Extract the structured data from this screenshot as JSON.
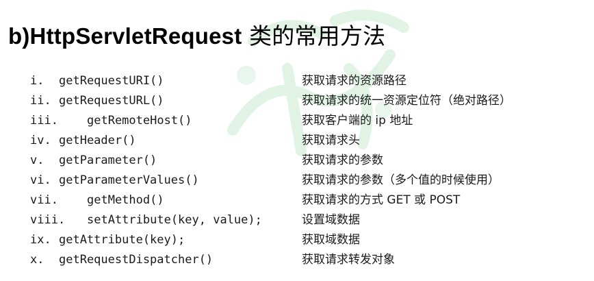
{
  "title": {
    "latin": "b)HttpServletRequest",
    "cjk": " 类的常用方法"
  },
  "rows": [
    {
      "num": "i.",
      "method": "getRequestURI()",
      "desc": "获取请求的资源路径"
    },
    {
      "num": "ii.",
      "method": "getRequestURL()",
      "desc": "获取请求的统一资源定位符（绝对路径）"
    },
    {
      "num": "iii.",
      "method": "getRemoteHost()",
      "desc": "获取客户端的 ip 地址"
    },
    {
      "num": "iv.",
      "method": "getHeader()",
      "desc": "获取请求头"
    },
    {
      "num": "v.",
      "method": "getParameter()",
      "desc": "获取请求的参数"
    },
    {
      "num": "vi.",
      "method": "getParameterValues()",
      "desc": "获取请求的参数（多个值的时候使用）"
    },
    {
      "num": "vii.",
      "method": "getMethod()",
      "desc": "获取请求的方式 GET 或 POST"
    },
    {
      "num": "viii.",
      "method": "setAttribute(key, value);",
      "desc": "设置域数据"
    },
    {
      "num": "ix.",
      "method": "getAttribute(key);",
      "desc": "获取域数据"
    },
    {
      "num": "x.",
      "method": "getRequestDispatcher()",
      "desc": "获取请求转发对象"
    }
  ],
  "watermark_color": "#cfe9d6"
}
